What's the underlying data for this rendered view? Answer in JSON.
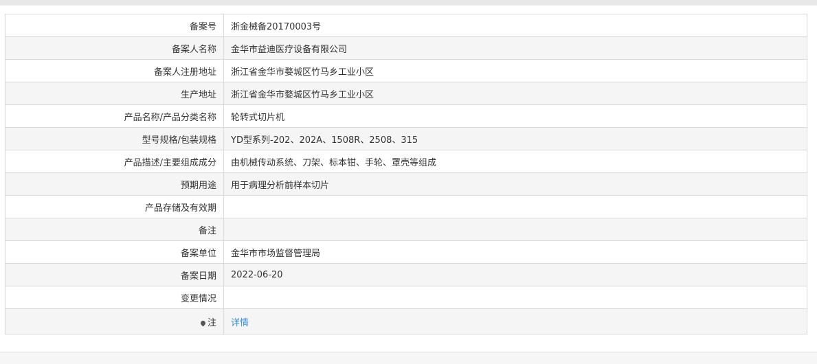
{
  "rows": [
    {
      "label": "备案号",
      "value": "浙金械备20170003号"
    },
    {
      "label": "备案人名称",
      "value": "金华市益迪医疗设备有限公司"
    },
    {
      "label": "备案人注册地址",
      "value": "浙江省金华市婺城区竹马乡工业小区"
    },
    {
      "label": "生产地址",
      "value": "浙江省金华市婺城区竹马乡工业小区"
    },
    {
      "label": "产品名称/产品分类名称",
      "value": "轮转式切片机"
    },
    {
      "label": "型号规格/包装规格",
      "value": "YD型系列-202、202A、1508R、2508、315"
    },
    {
      "label": "产品描述/主要组成成分",
      "value": "由机械传动系统、刀架、标本钳、手轮、罩壳等组成"
    },
    {
      "label": "预期用途",
      "value": "用于病理分析前样本切片"
    },
    {
      "label": "产品存储及有效期",
      "value": ""
    },
    {
      "label": "备注",
      "value": ""
    },
    {
      "label": "备案单位",
      "value": "金华市市场监督管理局"
    },
    {
      "label": "备案日期",
      "value": "2022-06-20"
    },
    {
      "label": "变更情况",
      "value": ""
    }
  ],
  "note": {
    "icon": "pin-icon",
    "label": "注",
    "link_text": "详情",
    "link_color": "#3a8ddc"
  }
}
